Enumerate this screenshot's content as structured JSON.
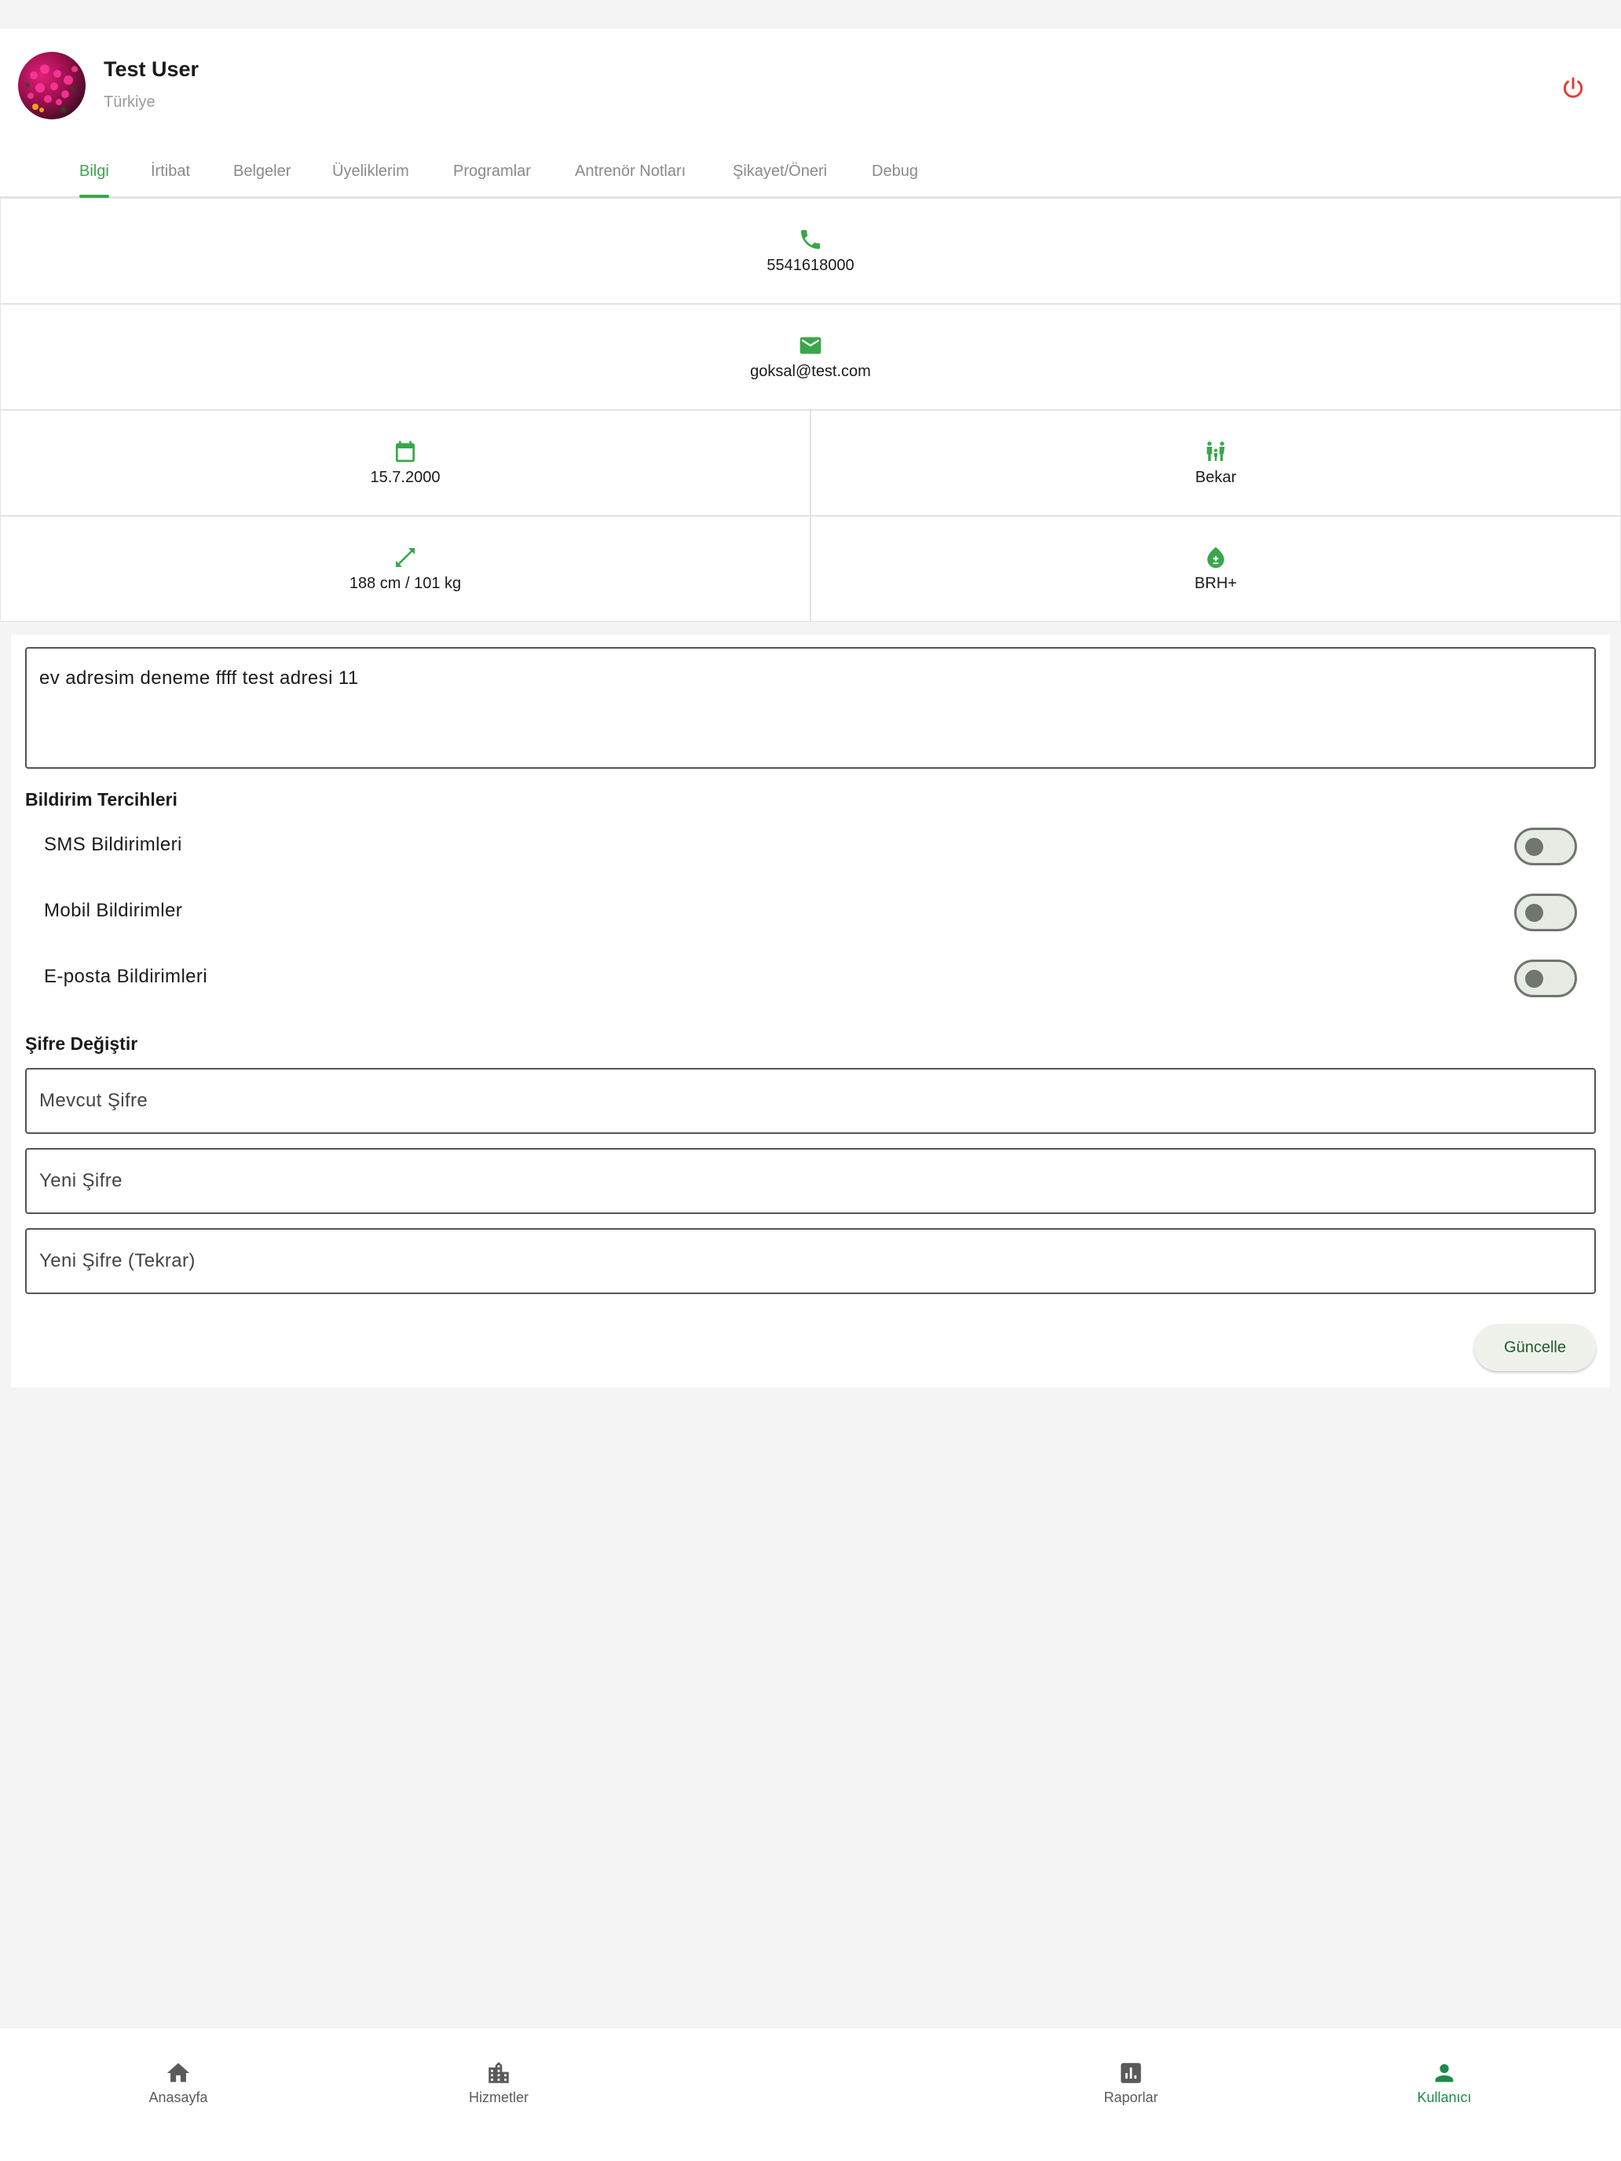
{
  "profile": {
    "name": "Test User",
    "country": "Türkiye"
  },
  "tabs": [
    {
      "label": "Bilgi",
      "active": true
    },
    {
      "label": "İrtibat"
    },
    {
      "label": "Belgeler"
    },
    {
      "label": "Üyeliklerim"
    },
    {
      "label": "Programlar"
    },
    {
      "label": "Antrenör Notları"
    },
    {
      "label": "Şikayet/Öneri"
    },
    {
      "label": "Debug"
    }
  ],
  "info": {
    "phone": {
      "icon": "phone-icon",
      "value": "5541618000"
    },
    "email": {
      "icon": "email-icon",
      "value": "goksal@test.com"
    },
    "birthdate": {
      "icon": "calendar-icon",
      "value": "15.7.2000"
    },
    "marital": {
      "icon": "family-icon",
      "value": "Bekar"
    },
    "body": {
      "icon": "height-weight-icon",
      "value": "188 cm / 101 kg"
    },
    "blood": {
      "icon": "blood-drop-icon",
      "value": "BRH+"
    }
  },
  "address": {
    "value": "ev adresim deneme ffff test adresi 11"
  },
  "notifications": {
    "title": "Bildirim Tercihleri",
    "items": [
      {
        "label": "SMS Bildirimleri",
        "enabled": false
      },
      {
        "label": "Mobil Bildirimler",
        "enabled": false
      },
      {
        "label": "E-posta Bildirimleri",
        "enabled": false
      }
    ]
  },
  "password": {
    "title": "Şifre Değiştir",
    "current_placeholder": "Mevcut Şifre",
    "new_placeholder": "Yeni Şifre",
    "repeat_placeholder": "Yeni Şifre (Tekrar)",
    "submit_label": "Güncelle"
  },
  "bottom_nav": [
    {
      "label": "Anasayfa",
      "icon": "home-icon"
    },
    {
      "label": "Hizmetler",
      "icon": "building-icon"
    },
    {
      "label": "Raporlar",
      "icon": "report-icon"
    },
    {
      "label": "Kullanıcı",
      "icon": "person-icon",
      "active": true
    }
  ],
  "colors": {
    "accent": "#3aa64a",
    "logout": "#e53935",
    "nav_active": "#1f8a4a",
    "background": "#f4f4f4"
  }
}
